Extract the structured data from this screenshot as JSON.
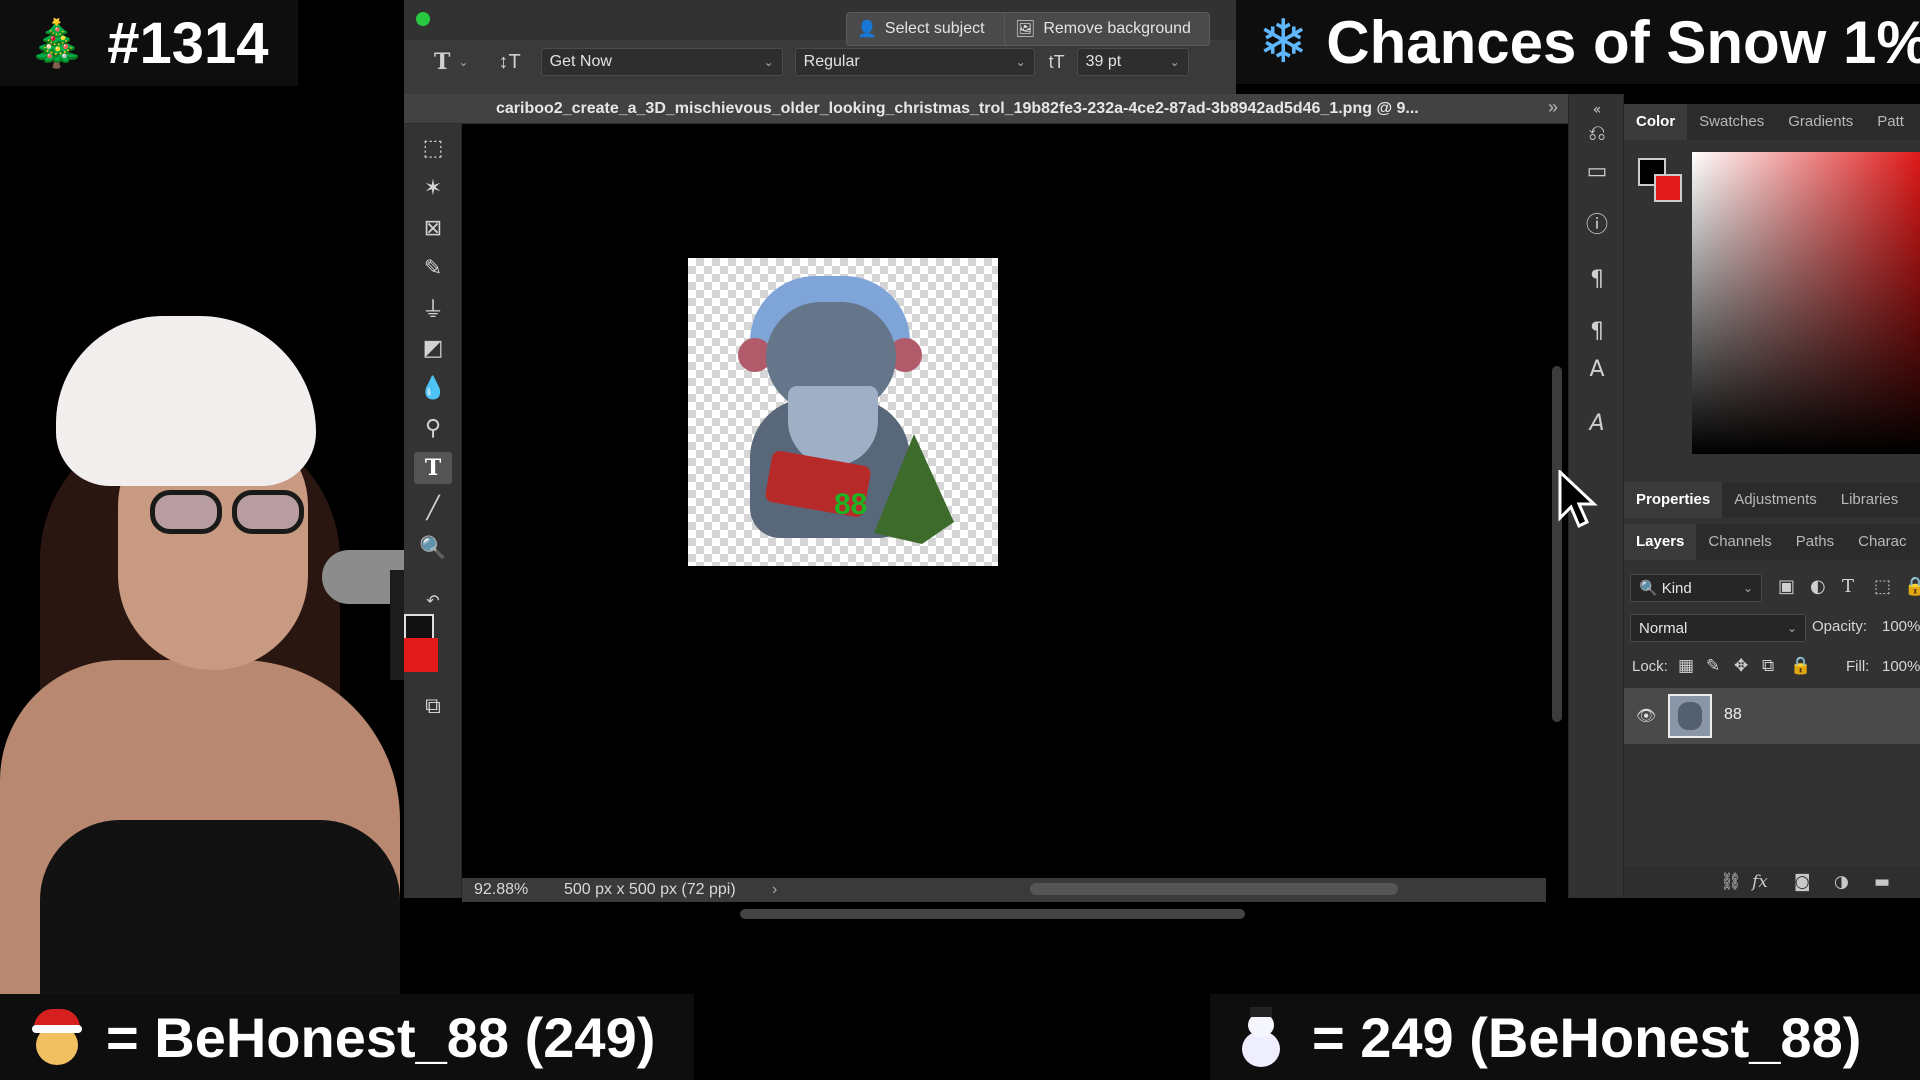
{
  "overlays": {
    "counter": "#1314",
    "snow": "Chances of Snow 1%",
    "bottom_left": "= BeHonest_88 (249)",
    "bottom_right": "= 249 (BeHonest_88)"
  },
  "options_bar": {
    "select_subject": "Select subject",
    "remove_background": "Remove background",
    "font_family": "Get Now",
    "font_style": "Regular",
    "font_size": "39 pt"
  },
  "document": {
    "title": "cariboo2_create_a_3D_mischievous_older_looking_christmas_trol_19b82fe3-232a-4ce2-87ad-3b8942ad5d46_1.png @ 9...",
    "zoom": "92.88%",
    "dimensions": "500 px x 500 px (72 ppi)",
    "artwork_text": "88"
  },
  "color_panel": {
    "tabs": [
      "Color",
      "Swatches",
      "Gradients",
      "Patt"
    ],
    "foreground": "#000000",
    "background": "#e21a1a"
  },
  "properties_panel": {
    "tabs": [
      "Properties",
      "Adjustments",
      "Libraries"
    ]
  },
  "layers_panel": {
    "tabs": [
      "Layers",
      "Channels",
      "Paths",
      "Charac"
    ],
    "filter": "Kind",
    "blend_mode": "Normal",
    "opacity_label": "Opacity:",
    "opacity_value": "100%",
    "lock_label": "Lock:",
    "fill_label": "Fill:",
    "fill_value": "100%",
    "layers": [
      {
        "name": "88",
        "visible": true
      }
    ]
  },
  "icons": {
    "tools": [
      "marquee-icon",
      "magic-wand-icon",
      "frame-icon",
      "healing-brush-icon",
      "clone-stamp-icon",
      "eraser-icon",
      "blur-icon",
      "dodge-icon",
      "type-tool-icon",
      "line-icon",
      "zoom-icon",
      "screen-mode-icon"
    ]
  }
}
